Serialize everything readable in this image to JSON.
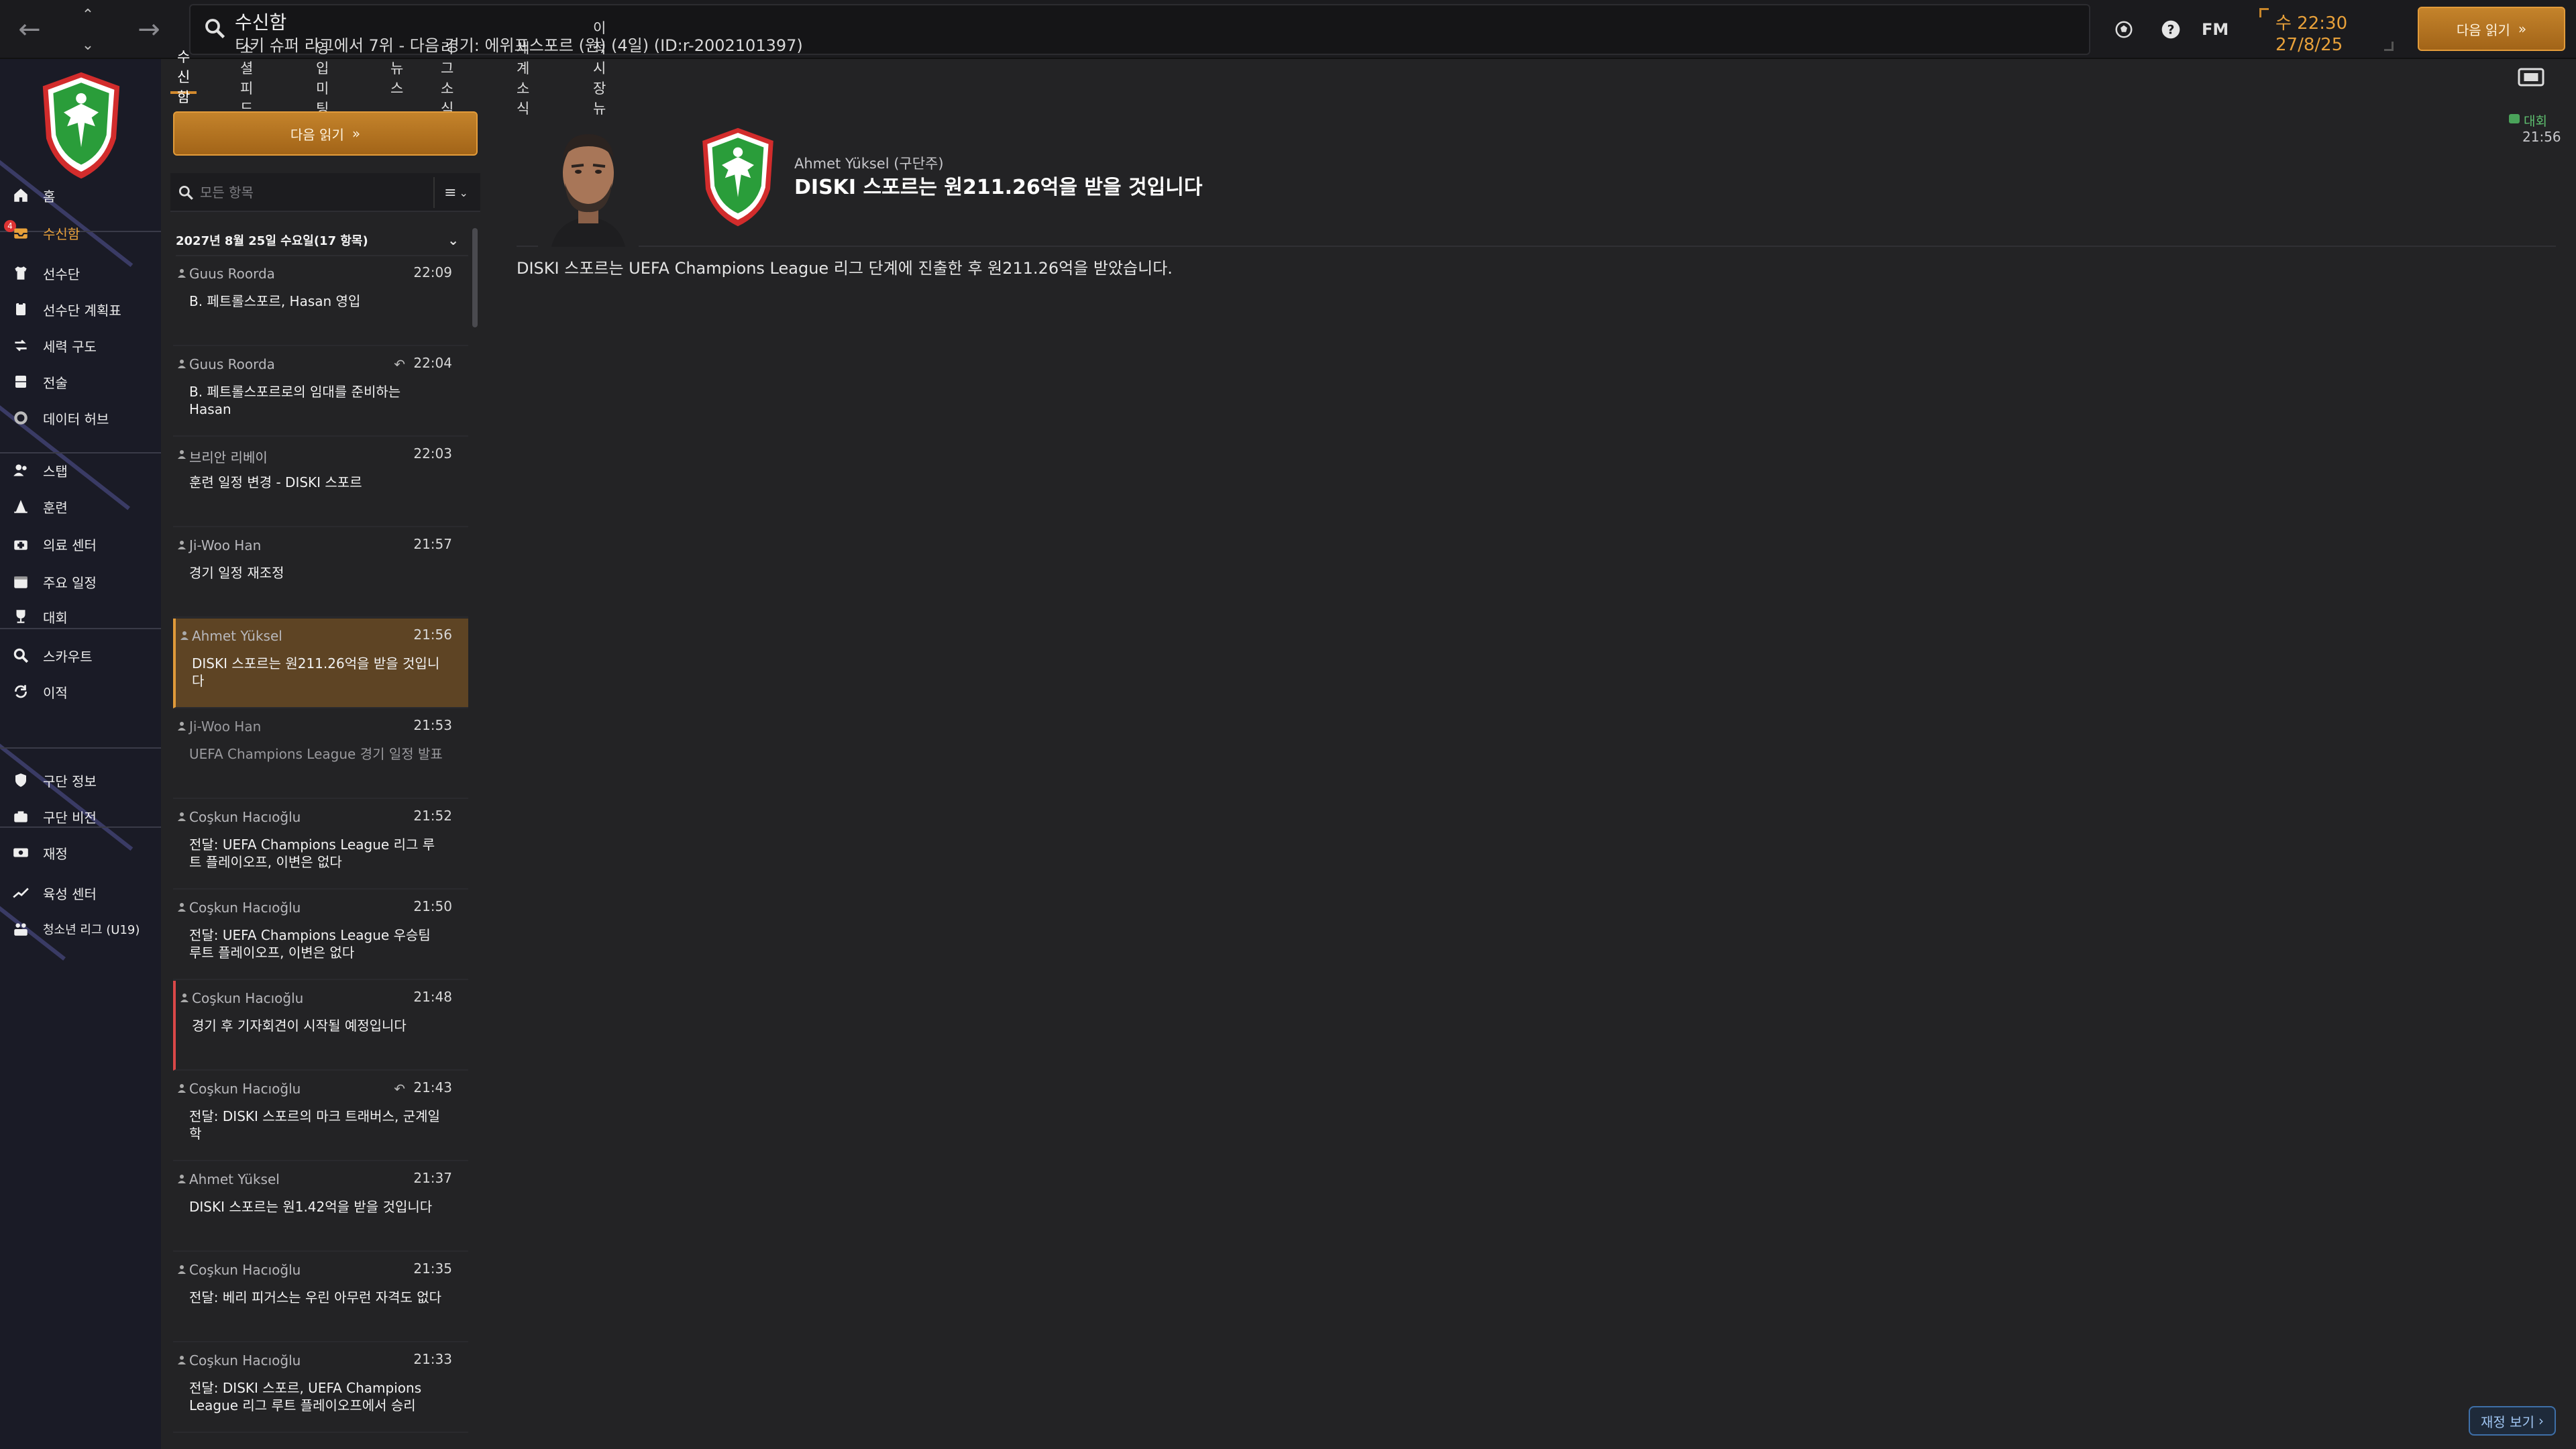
{
  "header": {
    "title": "수신함",
    "subtitle": "티키 슈퍼 리그에서 7위 - 다음 경기: 에위프스포르 (원) (4일) (ID:r-2002101397)",
    "fm_label": "FM",
    "time": "수 22:30",
    "date": "27/8/25",
    "continue_label": "다음 읽기"
  },
  "sidebar": {
    "inbox_badge": "4",
    "items": [
      {
        "label": "홈",
        "icon": "home-icon"
      },
      {
        "label": "수신함",
        "icon": "inbox-icon",
        "active": true
      },
      {
        "label": "선수단",
        "icon": "shirt-icon"
      },
      {
        "label": "선수단 계획표",
        "icon": "clipboard-icon"
      },
      {
        "label": "세력 구도",
        "icon": "dynamics-icon"
      },
      {
        "label": "전술",
        "icon": "tactics-board-icon"
      },
      {
        "label": "데이터 허브",
        "icon": "data-hub-icon"
      },
      {
        "label": "스탭",
        "icon": "staff-icon"
      },
      {
        "label": "훈련",
        "icon": "training-cone-icon"
      },
      {
        "label": "의료 센터",
        "icon": "medical-kit-icon"
      },
      {
        "label": "주요 일정",
        "icon": "calendar-icon"
      },
      {
        "label": "대회",
        "icon": "trophy-icon"
      },
      {
        "label": "스카우트",
        "icon": "scout-magnifier-icon"
      },
      {
        "label": "이적",
        "icon": "transfer-arrows-icon"
      },
      {
        "label": "구단 정보",
        "icon": "shield-icon"
      },
      {
        "label": "구단 비전",
        "icon": "vision-icon"
      },
      {
        "label": "재정",
        "icon": "finance-icon"
      },
      {
        "label": "육성 센터",
        "icon": "development-chart-icon"
      },
      {
        "label": "청소년 리그 (U19)",
        "icon": "youth-team-icon"
      }
    ]
  },
  "tabs": [
    "수신함",
    "소셜 피드",
    "영입 미팅",
    "뉴스",
    "리그 소식",
    "세계 소식",
    "이적 시장 뉴스"
  ],
  "list": {
    "continue_label": "다음 읽기",
    "search_placeholder": "모든 항목",
    "filter_label": "≡",
    "group_header": "2027년 8월 25일 수요일(17 항목)",
    "messages": [
      {
        "sender": "Guus Roorda",
        "time": "22:09",
        "subject": "B. 페트롤스포르, Hasan 영입"
      },
      {
        "sender": "Guus Roorda",
        "time": "22:04",
        "subject": "B. 페트롤스포르로의 임대를 준비하는 Hasan",
        "replied": true
      },
      {
        "sender": "브리안 리베이",
        "time": "22:03",
        "subject": "훈련 일정 변경 - DISKI 스포르"
      },
      {
        "sender": "Ji-Woo Han",
        "time": "21:57",
        "subject": "경기 일정 재조정"
      },
      {
        "sender": "Ahmet Yüksel",
        "time": "21:56",
        "subject": "DISKI 스포르는 원211.26억을 받을 것입니다",
        "selected": true
      },
      {
        "sender": "Ji-Woo Han",
        "time": "21:53",
        "subject": "UEFA Champions League 경기 일정 발표",
        "faded": true
      },
      {
        "sender": "Coşkun Hacıoğlu",
        "time": "21:52",
        "subject": "전달: UEFA Champions League 리그 루트 플레이오프, 이변은 없다"
      },
      {
        "sender": "Coşkun Hacıoğlu",
        "time": "21:50",
        "subject": "전달: UEFA Champions League 우승팀 루트 플레이오프, 이변은 없다"
      },
      {
        "sender": "Coşkun Hacıoğlu",
        "time": "21:48",
        "subject": "경기 후 기자회견이 시작될 예정입니다",
        "flagged": true
      },
      {
        "sender": "Coşkun Hacıoğlu",
        "time": "21:43",
        "subject": "전달: DISKI 스포르의 마크 트래버스, 군계일학",
        "replied": true
      },
      {
        "sender": "Ahmet Yüksel",
        "time": "21:37",
        "subject": "DISKI 스포르는 원1.42억을 받을 것입니다"
      },
      {
        "sender": "Coşkun Hacıoğlu",
        "time": "21:35",
        "subject": "전달: 베리 피거스는 우린 아무런 자격도 없다"
      },
      {
        "sender": "Coşkun Hacıoğlu",
        "time": "21:33",
        "subject": "전달: DISKI 스포르, UEFA Champions League 리그 루트 플레이오프에서 승리"
      }
    ]
  },
  "detail": {
    "sender": "Ahmet Yüksel (구단주)",
    "subject": "DISKI 스포르는 원211.26억을 받을 것입니다",
    "tag": "대회",
    "time": "21:56",
    "body": "DISKI 스포르는 UEFA Champions League 리그 단계에 진출한 후 원211.26억을 받았습니다.",
    "finance_button": "재정 보기"
  },
  "colors": {
    "accent": "#d28a2e",
    "selected_row": "#5e4424",
    "flag": "#d94848",
    "sidebar_bg": "#1a1b26",
    "tag_green": "#5fc070"
  }
}
